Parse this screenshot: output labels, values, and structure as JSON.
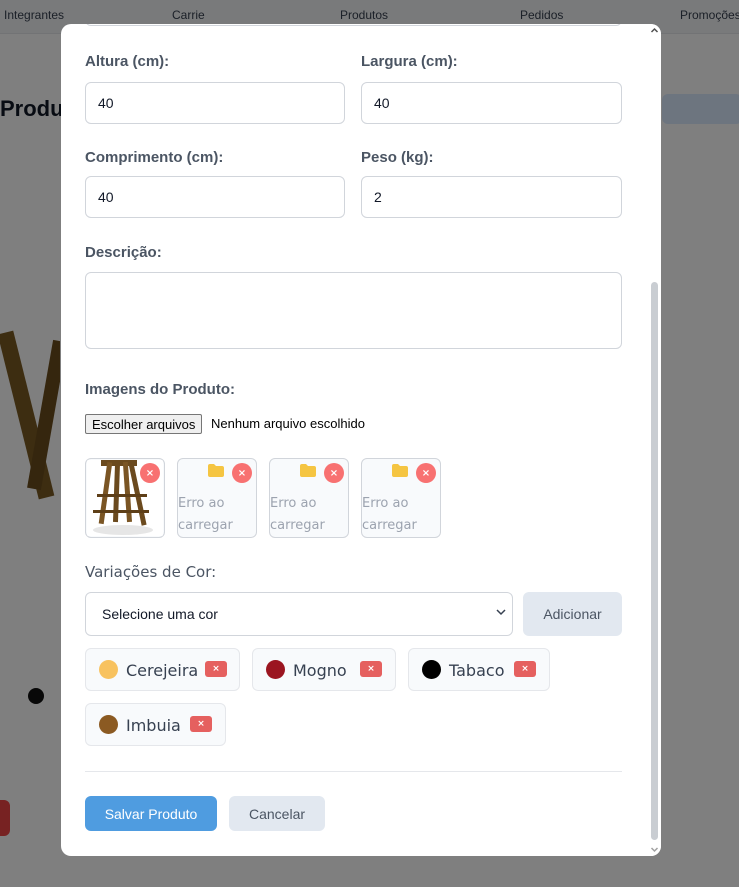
{
  "background": {
    "tabs": [
      "Integrantes",
      "Carrie",
      "Produtos",
      "Pedidos",
      "Promoções"
    ],
    "page_title": "Produtos"
  },
  "form": {
    "height": {
      "label": "Altura (cm):",
      "value": "40"
    },
    "width": {
      "label": "Largura (cm):",
      "value": "40"
    },
    "length": {
      "label": "Comprimento (cm):",
      "value": "40"
    },
    "weight": {
      "label": "Peso (kg):",
      "value": "2"
    },
    "description": {
      "label": "Descrição:",
      "value": ""
    },
    "images": {
      "label": "Imagens do Produto:",
      "choose_button": "Escolher arquivos",
      "status": "Nenhum arquivo escolhido",
      "thumbnails": [
        {
          "kind": "image",
          "alt": "stool"
        },
        {
          "kind": "error",
          "line1": "Erro ao",
          "line2": "carregar"
        },
        {
          "kind": "error",
          "line1": "Erro ao",
          "line2": "carregar"
        },
        {
          "kind": "error",
          "line1": "Erro ao",
          "line2": "carregar"
        }
      ],
      "remove_symbol": "×"
    },
    "colors": {
      "label": "Variações de Cor:",
      "select_value": "Selecione uma cor",
      "add_button": "Adicionar",
      "chips": [
        {
          "name": "Cerejeira",
          "color": "#f8c25f"
        },
        {
          "name": "Mogno",
          "color": "#9b1520"
        },
        {
          "name": "Tabaco",
          "color": "#000000"
        },
        {
          "name": "Imbuia",
          "color": "#8b5a22"
        }
      ],
      "remove_symbol": "×"
    },
    "save_button": "Salvar Produto",
    "cancel_button": "Cancelar"
  },
  "colors": {
    "primary": "#4f9ce0",
    "secondary": "#e2e8f0",
    "danger": "#e5605f"
  }
}
